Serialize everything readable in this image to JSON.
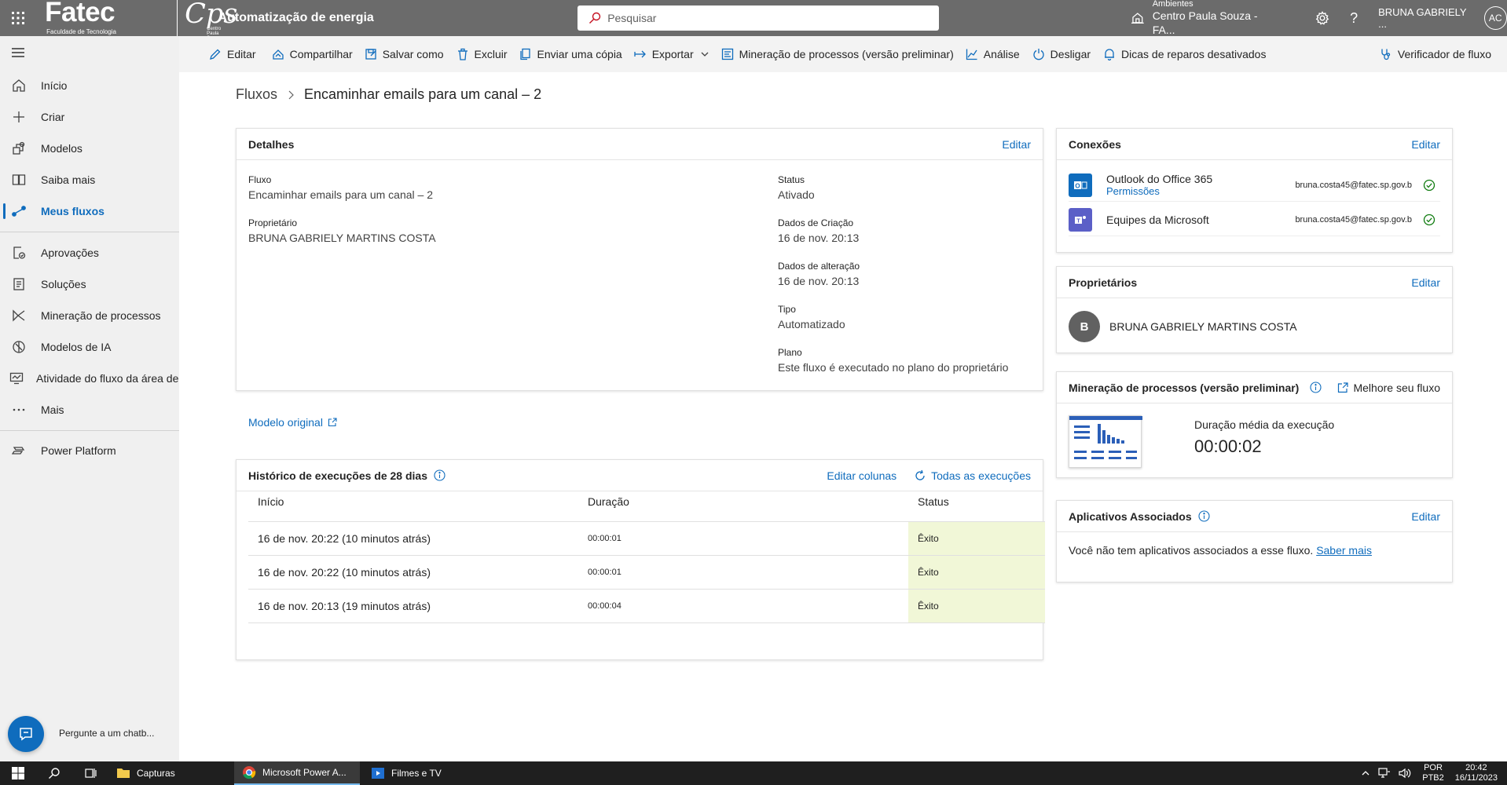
{
  "topbar": {
    "logo_main": "Fatec",
    "logo_sub": "Faculdade de Tecnologia",
    "logo_cps": "Cps",
    "logo_cps_sub": "Centro Paula Souza",
    "app_title": "Automatização de energia",
    "search_placeholder": "Pesquisar",
    "env_label": "Ambientes",
    "env_value": "Centro Paula Souza - FA...",
    "help": "?",
    "user_name": "BRUNA GABRIELY ...",
    "user_initials": "AC"
  },
  "sidebar": {
    "items": [
      {
        "label": "Início"
      },
      {
        "label": "Criar"
      },
      {
        "label": "Modelos"
      },
      {
        "label": "Saiba mais"
      },
      {
        "label": "Meus fluxos"
      },
      {
        "label": "Aprovações"
      },
      {
        "label": "Soluções"
      },
      {
        "label": "Mineração de processos"
      },
      {
        "label": "Modelos de IA"
      },
      {
        "label": "Atividade do fluxo da área de trabalho"
      },
      {
        "label": "Mais"
      },
      {
        "label": "Power Platform"
      }
    ],
    "chatbot_label": "Pergunte a um chatb..."
  },
  "cmdbar": {
    "edit": "Editar",
    "share": "Compartilhar",
    "save_as": "Salvar como",
    "delete": "Excluir",
    "send_copy": "Enviar uma cópia",
    "export": "Exportar",
    "process_mining": "Mineração de processos (versão preliminar)",
    "analysis": "Análise",
    "turn_off": "Desligar",
    "repair_tips": "Dicas de reparos desativados",
    "flow_checker": "Verificador de fluxo"
  },
  "breadcrumb": {
    "root": "Fluxos",
    "current": "Encaminhar emails para um canal – 2"
  },
  "details": {
    "title": "Detalhes",
    "edit": "Editar",
    "flow_label": "Fluxo",
    "flow_value": "Encaminhar emails para um canal – 2",
    "owner_label": "Proprietário",
    "owner_value": "BRUNA GABRIELY MARTINS COSTA",
    "status_label": "Status",
    "status_value": "Ativado",
    "created_label": "Dados de Criação",
    "created_value": "16 de nov. 20:13",
    "modified_label": "Dados de alteração",
    "modified_value": "16 de nov. 20:13",
    "type_label": "Tipo",
    "type_value": "Automatizado",
    "plan_label": "Plano",
    "plan_value": "Este fluxo é executado no plano do proprietário",
    "original_template": "Modelo original"
  },
  "history": {
    "title": "Histórico de execuções de 28 dias",
    "edit_columns": "Editar colunas",
    "all_runs": "Todas as execuções",
    "columns": [
      "Início",
      "Duração",
      "Status"
    ],
    "rows": [
      {
        "start": "16 de nov. 20:22 (10 minutos atrás)",
        "duration": "00:00:01",
        "status": "Êxito"
      },
      {
        "start": "16 de nov. 20:22 (10 minutos atrás)",
        "duration": "00:00:01",
        "status": "Êxito"
      },
      {
        "start": "16 de nov. 20:13 (19 minutos atrás)",
        "duration": "00:00:04",
        "status": "Êxito"
      }
    ]
  },
  "connections": {
    "title": "Conexões",
    "edit": "Editar",
    "items": [
      {
        "name": "Outlook do Office 365",
        "permissions": "Permissões",
        "email": "bruna.costa45@fatec.sp.gov.b",
        "color": "#0f6cbd"
      },
      {
        "name": "Equipes da Microsoft",
        "email": "bruna.costa45@fatec.sp.gov.b",
        "color": "#5b5fc7"
      }
    ]
  },
  "owners": {
    "title": "Proprietários",
    "edit": "Editar",
    "initial": "B",
    "name": "BRUNA GABRIELY MARTINS COSTA"
  },
  "mining": {
    "title": "Mineração de processos (versão preliminar)",
    "improve": "Melhore seu fluxo",
    "avg_label": "Duração média da execução",
    "avg_value": "00:00:02"
  },
  "apps": {
    "title": "Aplicativos Associados",
    "edit": "Editar",
    "text": "Você não tem aplicativos associados a esse fluxo.",
    "link": "Saber mais"
  },
  "taskbar": {
    "apps": [
      "Capturas",
      "Microsoft Power A...",
      "Filmes e TV"
    ],
    "lang": "POR",
    "lang_sub": "PTB2",
    "time": "20:42",
    "date": "16/11/2023"
  },
  "colors": {
    "accent": "#0f6cbd",
    "topbar": "#6b6b6b",
    "success_bg": "#f1f7d7"
  }
}
